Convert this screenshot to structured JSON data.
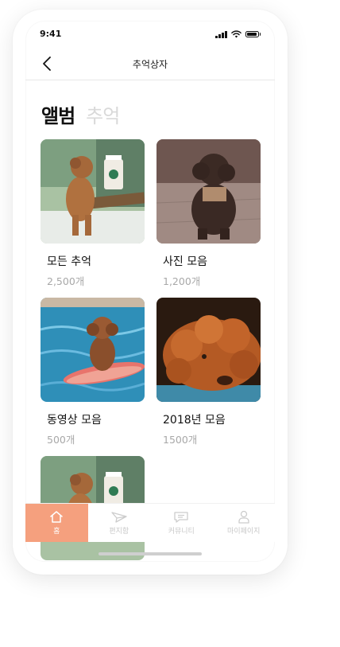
{
  "status_bar": {
    "time": "9:41"
  },
  "nav": {
    "title": "추억상자",
    "back_icon": "chevron-left-icon"
  },
  "segments": [
    {
      "label": "앨범",
      "active": true
    },
    {
      "label": "추억",
      "active": false
    }
  ],
  "albums": [
    {
      "title": "모든 추억",
      "count": "2,500개",
      "photo": "puppy-with-starbucks-cup"
    },
    {
      "title": "사진 모음",
      "count": "1,200개",
      "photo": "dark-poodle-sitting"
    },
    {
      "title": "동영상 모음",
      "count": "500개",
      "photo": "puppy-on-surfboard-in-pool"
    },
    {
      "title": "2018년 모음",
      "count": "1500개",
      "photo": "curly-orange-dog-lying"
    },
    {
      "title": "",
      "count": "",
      "photo": "puppy-with-starbucks-cup"
    }
  ],
  "tab_bar": {
    "tabs": [
      {
        "label": "홈",
        "icon": "home-icon",
        "active": true
      },
      {
        "label": "편지함",
        "icon": "paper-plane-icon",
        "active": false
      },
      {
        "label": "커뮤니티",
        "icon": "chat-bubble-icon",
        "active": false
      },
      {
        "label": "마이페이지",
        "icon": "person-icon",
        "active": false
      }
    ]
  },
  "colors": {
    "accent": "#f5a07e",
    "inactive_text": "#c8c8c8",
    "segment_inactive": "#d9d9d9"
  }
}
